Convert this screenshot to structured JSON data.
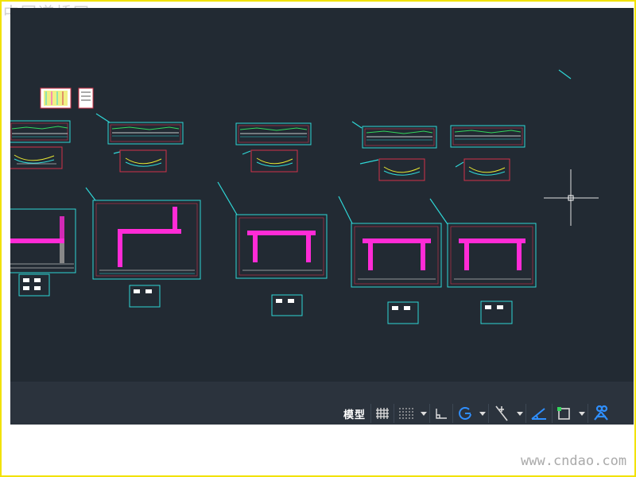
{
  "watermarks": {
    "top_left": "中国道桥网",
    "bottom_right": "www.cndao.com"
  },
  "app": {
    "type": "CAD drawing workspace",
    "background_color": "#222a33",
    "linework_colors": {
      "frame": "#2fd6d6",
      "red": "#d2334a",
      "magenta": "#ff2bd6",
      "yellow": "#e6e633",
      "green": "#33d65c"
    }
  },
  "statusbar": {
    "model_label": "模型",
    "icons": [
      "grid-icon",
      "snap-icon",
      "ortho-icon",
      "polar-icon",
      "object-snap-tracking-icon",
      "isometric-icon",
      "annotation-scale-icon",
      "annotation-monitor-icon"
    ]
  },
  "cursor": {
    "name": "crosshair-cursor"
  }
}
